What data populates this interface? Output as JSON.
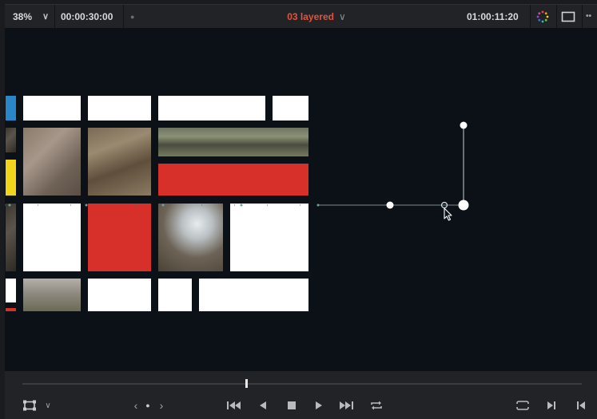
{
  "header": {
    "zoom": "38%",
    "zoom_caret": "∨",
    "timecode_left": "00:00:30:00",
    "dot": "●",
    "title": "03  layered",
    "title_caret": "∨",
    "timecode_right": "01:00:11:20"
  },
  "icons": {
    "color": "color-wheel-icon",
    "viewer_mode": "viewer-mode-icon",
    "more": "more-options-icon",
    "transform": "transform-overlay-icon",
    "prev_clip": "jump-to-start-icon",
    "play_reverse": "play-reverse-icon",
    "stop": "stop-icon",
    "play": "play-icon",
    "next_clip": "jump-to-end-icon",
    "loop": "loop-icon",
    "match_frame": "match-frame-icon",
    "next_edit": "next-edit-icon",
    "prev_edit": "prev-edit-icon"
  },
  "transport": {
    "prev_arrow": "‹",
    "center_dot": "●",
    "next_arrow": "›",
    "dropdown": "∨"
  },
  "playhead_position": 0.4
}
